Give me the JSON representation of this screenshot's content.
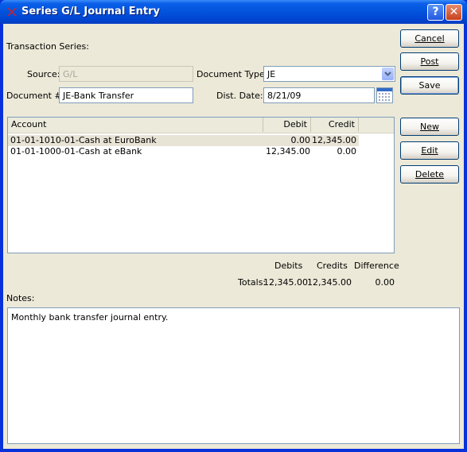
{
  "window": {
    "title": "Series G/L Journal Entry",
    "help_glyph": "?",
    "close_glyph": "✕"
  },
  "form": {
    "transaction_series_label": "Transaction Series:",
    "source_label": "Source:",
    "source_value": "G/L",
    "document_type_label": "Document Type:",
    "document_type_value": "JE",
    "document_number_label": "Document #:",
    "document_number_value": "JE-Bank Transfer",
    "dist_date_label": "Dist. Date:",
    "dist_date_value": "8/21/09"
  },
  "buttons": {
    "cancel": "Cancel",
    "post": "Post",
    "save": "Save",
    "new": "New",
    "edit": "Edit",
    "delete": "Delete"
  },
  "table": {
    "columns": [
      "Account",
      "Debit",
      "Credit"
    ],
    "rows": [
      {
        "account": "01-01-1010-01-Cash at EuroBank",
        "debit": "0.00",
        "credit": "12,345.00",
        "selected": true
      },
      {
        "account": "01-01-1000-01-Cash at eBank",
        "debit": "12,345.00",
        "credit": "0.00",
        "selected": false
      }
    ]
  },
  "totals": {
    "debits_label": "Debits",
    "credits_label": "Credits",
    "difference_label": "Difference",
    "totals_label": "Totals:",
    "debits": "12,345.00",
    "credits": "12,345.00",
    "difference": "0.00"
  },
  "notes": {
    "label": "Notes:",
    "text": "Monthly bank transfer journal entry."
  },
  "colors": {
    "titlebar": "#0353dc",
    "dialog_bg": "#ece9d8",
    "selected_row": "#e7e4d6"
  }
}
